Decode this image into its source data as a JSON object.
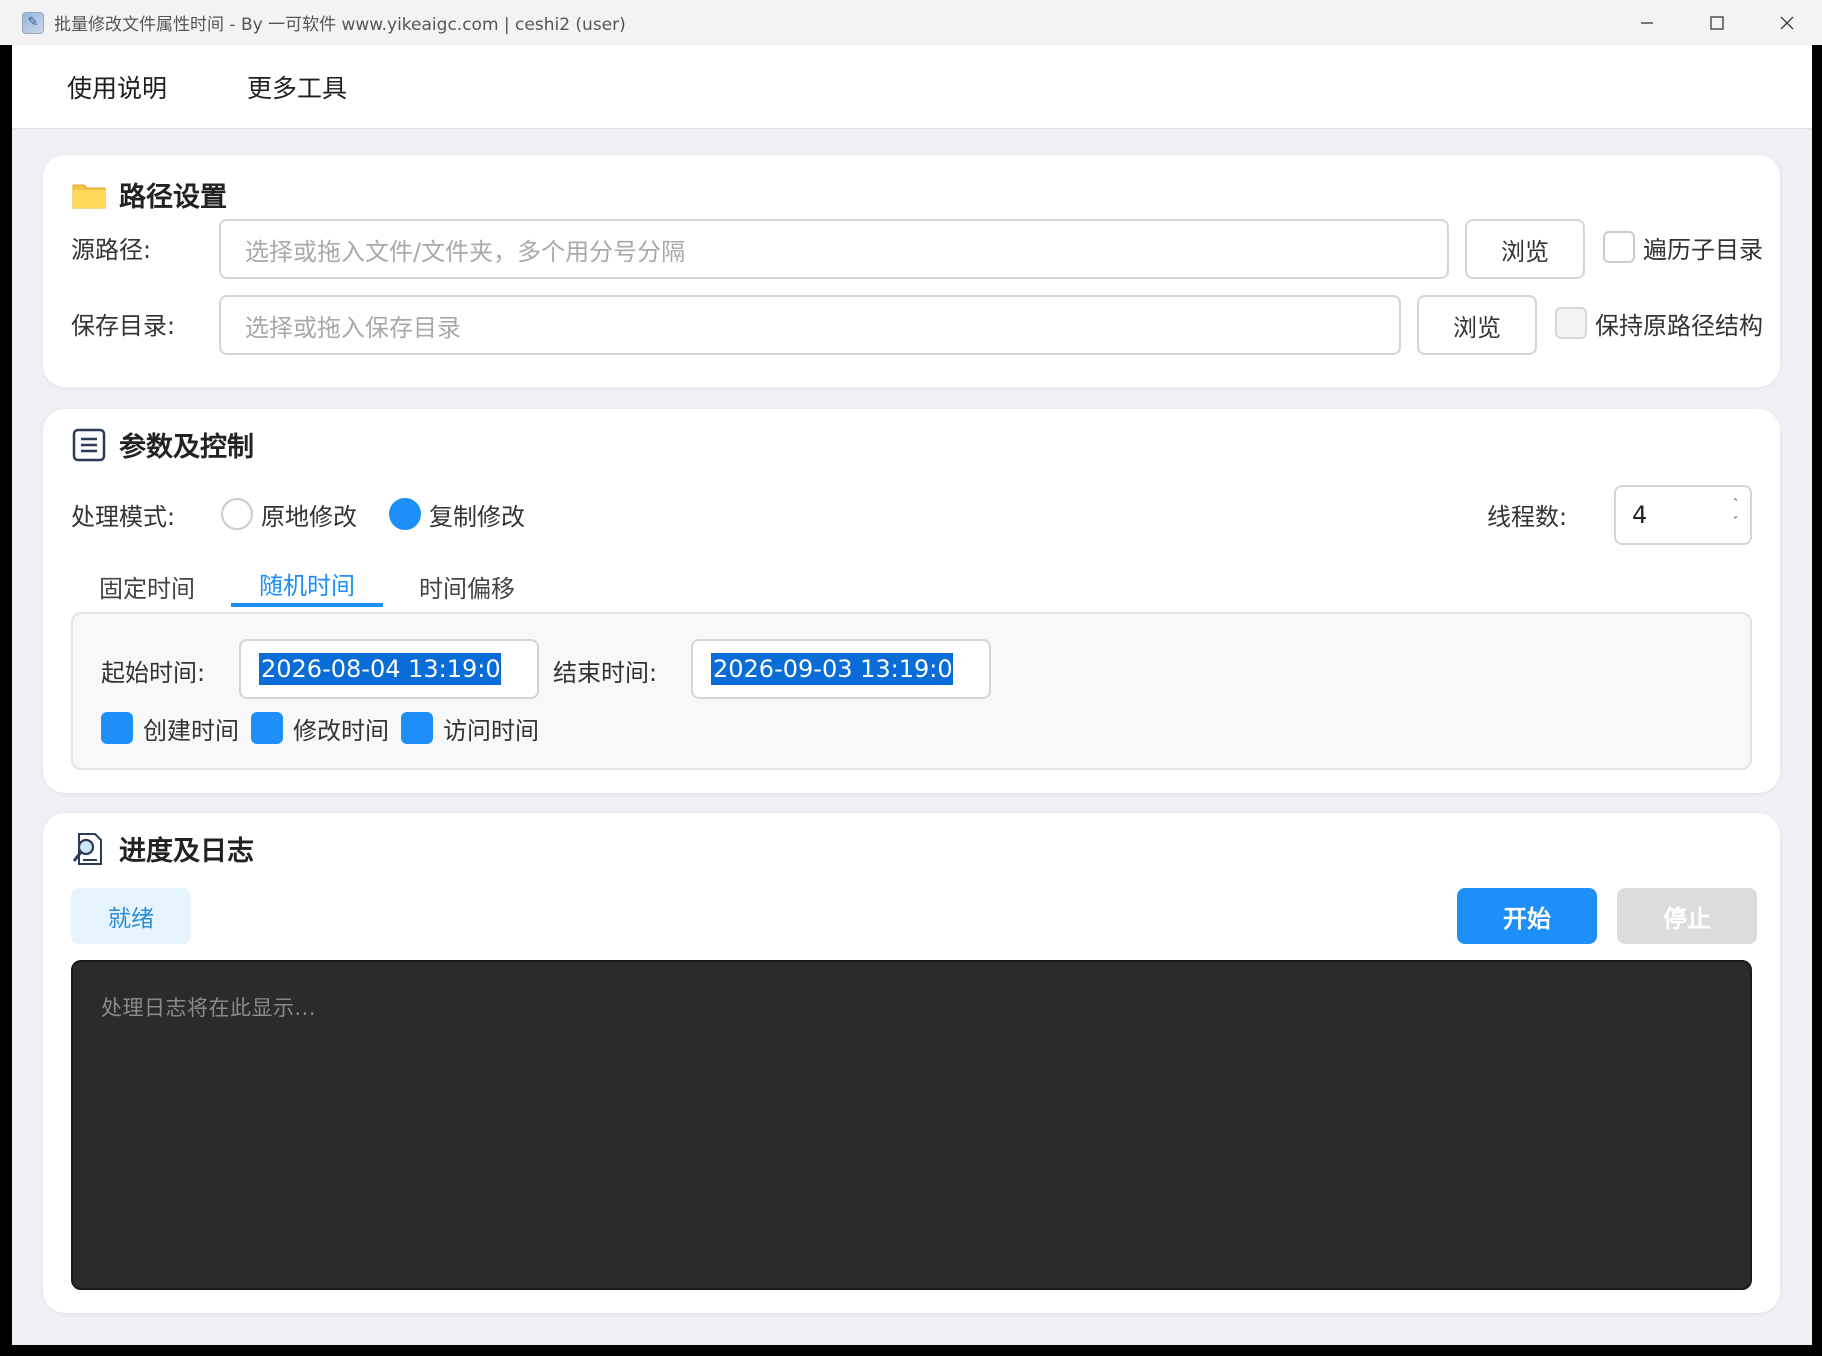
{
  "window": {
    "title": "批量修改文件属性时间 - By 一可软件 www.yikeaigc.com | ceshi2 (user)",
    "app_icon": "app-icon"
  },
  "menu": {
    "items": [
      "使用说明",
      "更多工具"
    ]
  },
  "path_settings": {
    "title": "路径设置",
    "icon": "folder-icon",
    "source_label": "源路径:",
    "source_placeholder": "选择或拖入文件/文件夹，多个用分号分隔",
    "source_browse": "浏览",
    "recurse_label": "遍历子目录",
    "recurse_checked": false,
    "save_label": "保存目录:",
    "save_placeholder": "选择或拖入保存目录",
    "save_browse": "浏览",
    "keep_structure_label": "保持原路径结构",
    "keep_structure_checked": false
  },
  "params": {
    "title": "参数及控制",
    "icon": "list-icon",
    "mode_label": "处理模式:",
    "mode_options": [
      "原地修改",
      "复制修改"
    ],
    "mode_selected": "复制修改",
    "threads_label": "线程数:",
    "threads_value": "4",
    "tabs": [
      "固定时间",
      "随机时间",
      "时间偏移"
    ],
    "active_tab": "随机时间",
    "start_label": "起始时间:",
    "start_value": "2026-08-04 13:19:0",
    "end_label": "结束时间:",
    "end_value": "2026-09-03 13:19:0",
    "time_types": [
      {
        "label": "创建时间",
        "checked": true
      },
      {
        "label": "修改时间",
        "checked": true
      },
      {
        "label": "访问时间",
        "checked": true
      }
    ]
  },
  "progress": {
    "title": "进度及日志",
    "icon": "search-document-icon",
    "status": "就绪",
    "start_button": "开始",
    "stop_button": "停止",
    "log_placeholder": "处理日志将在此显示..."
  },
  "colors": {
    "accent": "#1e8ef8",
    "log_bg": "#2b2b2b",
    "status_bg": "#e6f4fd"
  }
}
